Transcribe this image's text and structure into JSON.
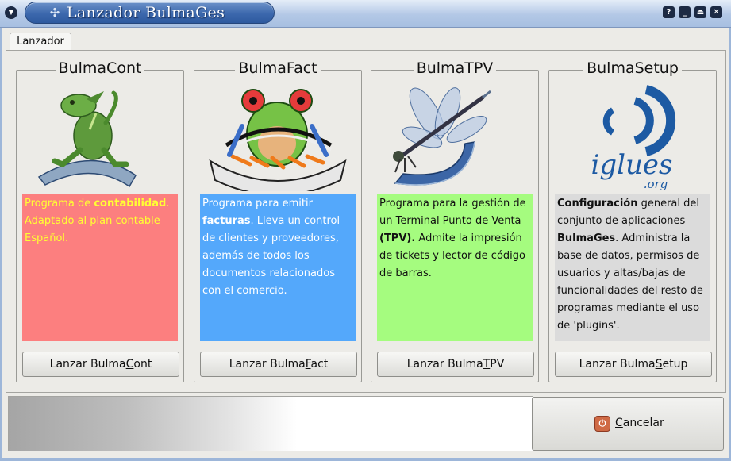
{
  "window": {
    "title": "Lanzador BulmaGes",
    "menu_icon": "chevron-down-icon",
    "title_icon": "bulmages-icon",
    "controls": [
      "help-icon",
      "minimize-icon",
      "maximize-icon",
      "close-icon"
    ]
  },
  "tab": {
    "label": "Lanzador"
  },
  "programs": [
    {
      "title": "BulmaCont",
      "logo": "iguana-logo",
      "desc_color": "#fc7f7f",
      "text_color": "#ffff33",
      "desc_parts": [
        "Programa de ",
        "contabilidad",
        ". Adaptado al plan contable Español."
      ],
      "button_pre": "Lanzar Bulma",
      "button_key": "C",
      "button_post": "ont"
    },
    {
      "title": "BulmaFact",
      "logo": "frog-logo",
      "desc_color": "#54a8fb",
      "text_color": "#ffffff",
      "desc_parts": [
        "Programa para emitir ",
        "facturas",
        ". Lleva un control de clientes y proveedores, además de todos los documentos relacionados con el comercio."
      ],
      "button_pre": "Lanzar Bulma",
      "button_key": "F",
      "button_post": "act"
    },
    {
      "title": "BulmaTPV",
      "logo": "dragonfly-logo",
      "desc_color": "#a5fc7f",
      "text_color": "#111111",
      "desc_parts": [
        "Programa para la gestión de un Terminal Punto de Venta ",
        "(TPV).",
        " Admite la impresión de tickets y lector de código de barras."
      ],
      "button_pre": "Lanzar Bulma",
      "button_key": "T",
      "button_post": "PV"
    },
    {
      "title": "BulmaSetup",
      "logo": "iglues-logo",
      "logo_text": "iglues",
      "logo_subtext": ".org",
      "desc_color": "#dbdbdb",
      "text_color": "#111111",
      "desc_parts": [
        "",
        "Configuración",
        " general del conjunto de aplicaciones ",
        "BulmaGes",
        ". Administra la base de datos, permisos de usuarios y altas/bajas de funcionalidades del resto de programas mediante el uso de 'plugins'."
      ],
      "button_pre": "Lanzar Bulma",
      "button_key": "S",
      "button_post": "etup"
    }
  ],
  "progress": {
    "value": 0
  },
  "cancel": {
    "icon": "power-icon",
    "key": "C",
    "rest": "ancelar"
  }
}
